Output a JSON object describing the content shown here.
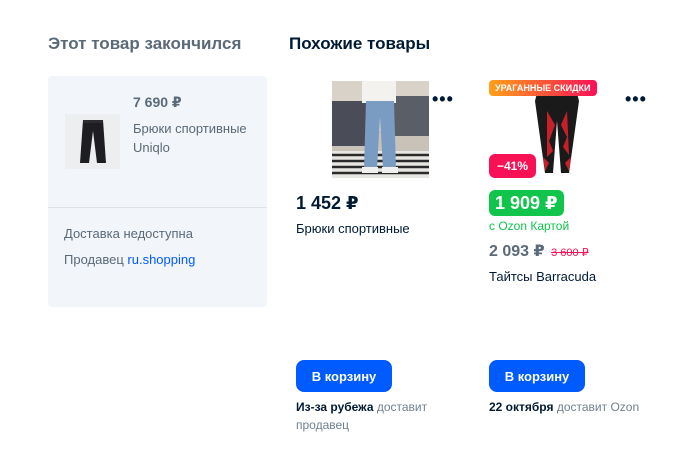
{
  "out_of_stock": {
    "title": "Этот товар закончился",
    "price": "7 690 ₽",
    "name": "Брюки спортивные Uniqlo",
    "delivery": "Доставка недоступна",
    "seller_label": "Продавец",
    "seller_name": "ru.shopping"
  },
  "similar": {
    "title": "Похожие товары",
    "products": [
      {
        "price": "1 452 ₽",
        "name": "Брюки спортивные",
        "cart_label": "В корзину",
        "delivery_bold": "Из-за рубежа",
        "delivery_rest": " доставит продавец",
        "more_icon": "more-dots-icon"
      },
      {
        "promo_badge": "УРАГАННЫЕ СКИДКИ",
        "discount": "−41%",
        "card_price": "1 909 ₽",
        "card_label": "с Ozon Картой",
        "price": "2 093 ₽",
        "old_price": "3 600 ₽",
        "name": "Тайтсы Barracuda",
        "cart_label": "В корзину",
        "delivery_bold": "22 октября",
        "delivery_rest": " доставит Ozon",
        "more_icon": "more-dots-icon"
      }
    ]
  },
  "colors": {
    "accent": "#005bff",
    "card_green": "#10c44c",
    "discount_pink": "#f91155"
  }
}
